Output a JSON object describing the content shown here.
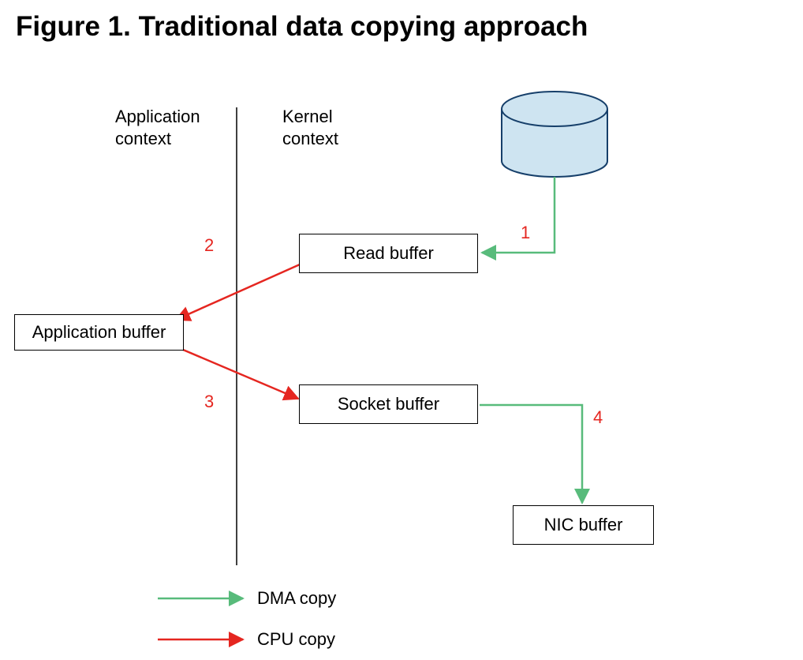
{
  "title": "Figure 1. Traditional data copying approach",
  "labels": {
    "app_context_line1": "Application",
    "app_context_line2": "context",
    "kernel_context_line1": "Kernel",
    "kernel_context_line2": "context"
  },
  "boxes": {
    "app_buffer": "Application buffer",
    "read_buffer": "Read buffer",
    "socket_buffer": "Socket buffer",
    "nic_buffer": "NIC buffer"
  },
  "steps": {
    "s1": "1",
    "s2": "2",
    "s3": "3",
    "s4": "4"
  },
  "legend": {
    "dma": "DMA copy",
    "cpu": "CPU copy"
  },
  "colors": {
    "green": "#58bb7b",
    "red": "#e52620",
    "cyl_fill": "#cee4f1",
    "cyl_stroke": "#163f6a"
  }
}
